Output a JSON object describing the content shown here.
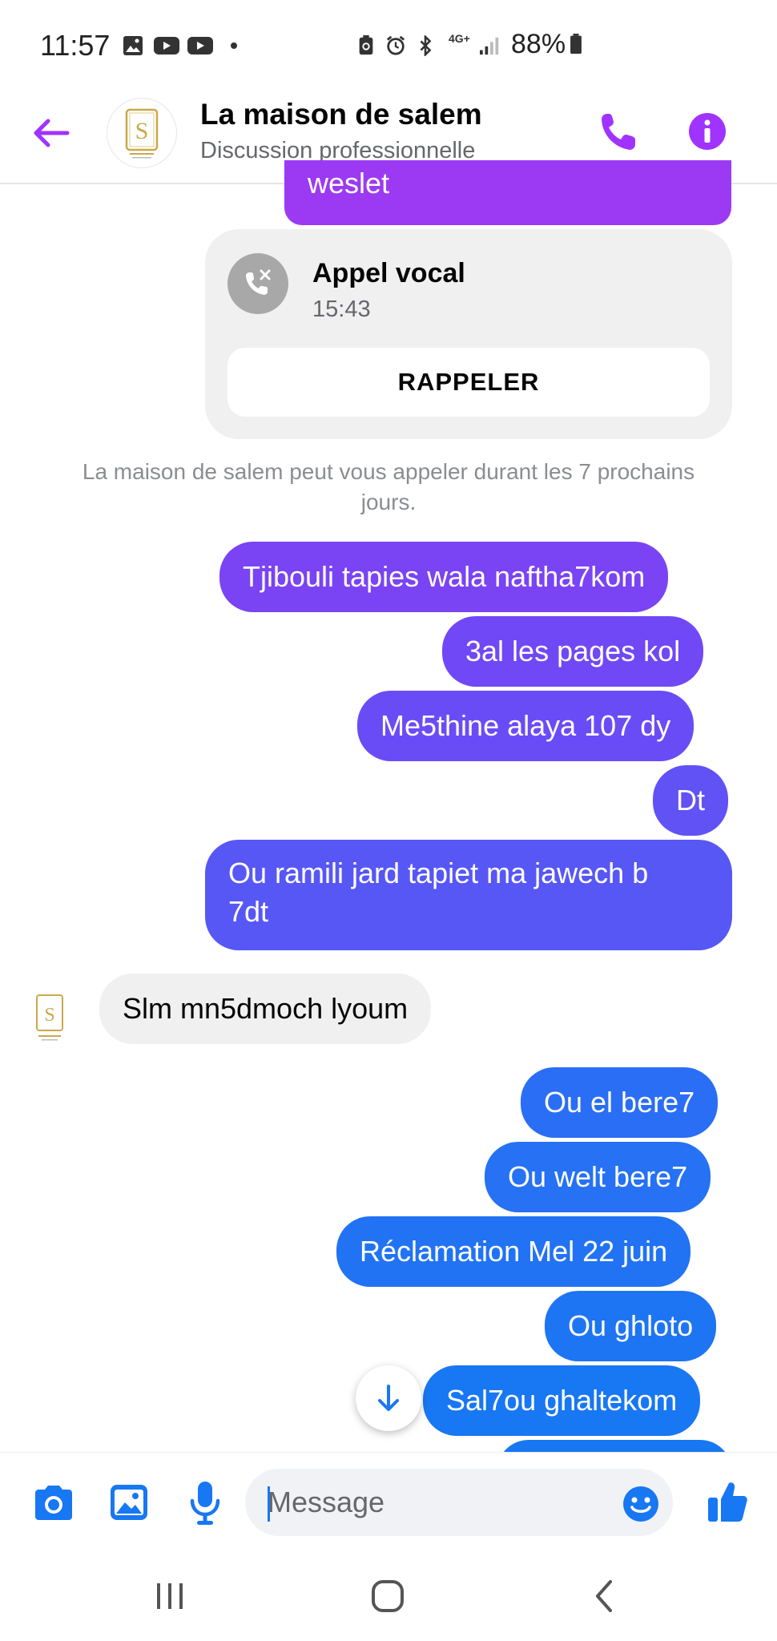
{
  "status_bar": {
    "time": "11:57",
    "battery": "88%",
    "network": "4G+"
  },
  "header": {
    "title": "La maison de salem",
    "subtitle": "Discussion professionnelle",
    "avatar_letter": "S",
    "back_icon": "arrow-left-icon",
    "call_icon": "phone-icon",
    "info_icon": "info-icon"
  },
  "messages": {
    "m0": "weslet",
    "call": {
      "title": "Appel vocal",
      "time": "15:43",
      "button": "RAPPELER"
    },
    "notice": "La maison de salem peut vous appeler durant les 7 prochains jours.",
    "m1": "Tjibouli tapies wala naftha7kom",
    "m2": "3al les pages kol",
    "m3": "Me5thine alaya 107 dy",
    "m4": "Dt",
    "m5_line1": "Ou ramili jard tapiet ma jawech b",
    "m5_line2": "7dt",
    "received": "Slm mn5dmoch lyoum",
    "m6": "Ou el bere7",
    "m7": "Ou welt bere7",
    "m8": "Réclamation Mel 22 juin",
    "m9": "Ou ghloto",
    "m10": "Sal7ou ghaltekom"
  },
  "composer": {
    "placeholder": "Message"
  },
  "colors": {
    "accent": "#a033ff",
    "bubble_purple": "#8a3cf0",
    "bubble_violet": "#6a4cf6",
    "bubble_blue": "#2a6ef5",
    "bubble_blue2": "#1877f2",
    "received": "#f0f0f0"
  }
}
